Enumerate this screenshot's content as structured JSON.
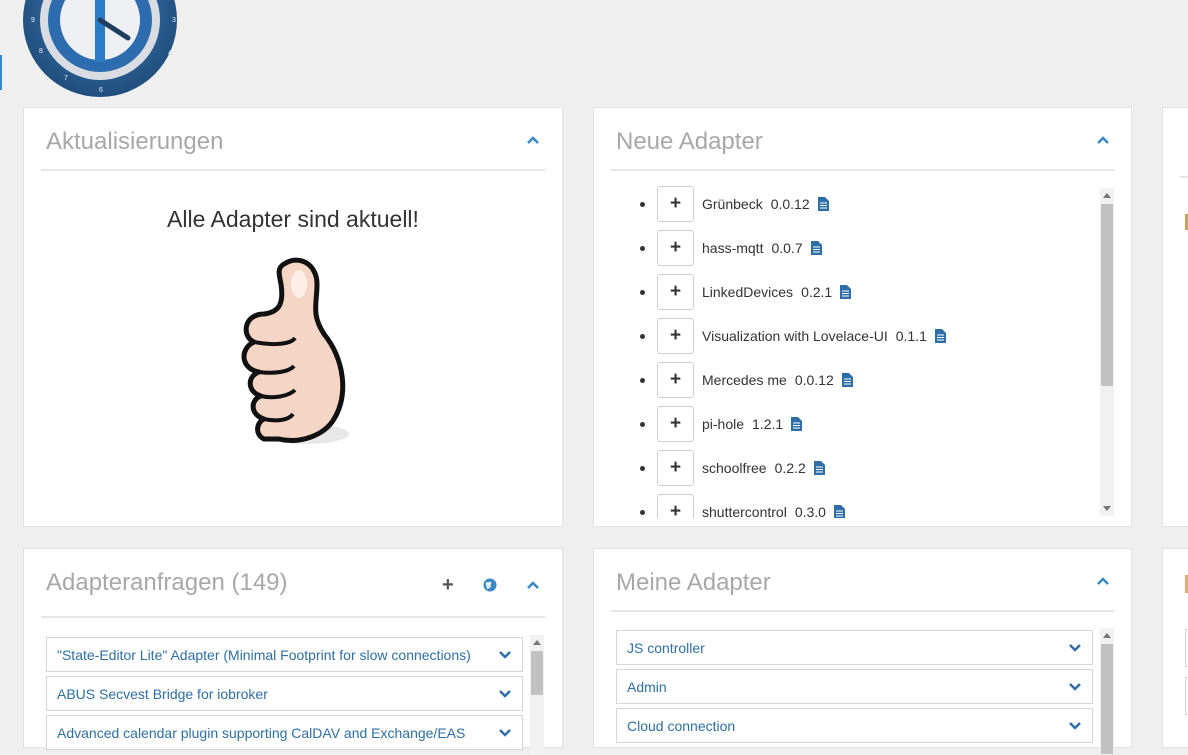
{
  "colors": {
    "accent": "#3a87c8",
    "title_gray": "#a8a8a8",
    "link_blue": "#2f6fa8"
  },
  "logo": {
    "icon": "iobroker-clock-logo"
  },
  "updates": {
    "title": "Aktualisierungen",
    "message": "Alle Adapter sind aktuell!",
    "illustration": "thumbs-up-icon",
    "collapse_icon": "chevron-up-icon"
  },
  "new_adapters": {
    "title": "Neue Adapter",
    "collapse_icon": "chevron-up-icon",
    "items": [
      {
        "name": "Grünbeck",
        "version": "0.0.12"
      },
      {
        "name": "hass-mqtt",
        "version": "0.0.7"
      },
      {
        "name": "LinkedDevices",
        "version": "0.2.1"
      },
      {
        "name": "Visualization with Lovelace-UI",
        "version": "0.1.1"
      },
      {
        "name": "Mercedes me",
        "version": "0.0.12"
      },
      {
        "name": "pi-hole",
        "version": "1.2.1"
      },
      {
        "name": "schoolfree",
        "version": "0.2.2"
      },
      {
        "name": "shuttercontrol",
        "version": "0.3.0"
      }
    ],
    "add_label": "+"
  },
  "requests": {
    "title": "Adapteranfragen (149)",
    "add_label": "+",
    "icons": [
      "plus-icon",
      "globe-icon",
      "chevron-up-icon"
    ],
    "items": [
      "\"State-Editor Lite\" Adapter (Minimal Footprint for slow connections)",
      "ABUS Secvest Bridge for iobroker",
      "Advanced calendar plugin supporting CalDAV and Exchange/EAS"
    ]
  },
  "my_adapters": {
    "title": "Meine Adapter",
    "collapse_icon": "chevron-up-icon",
    "items": [
      "JS controller",
      "Admin",
      "Cloud connection"
    ]
  }
}
